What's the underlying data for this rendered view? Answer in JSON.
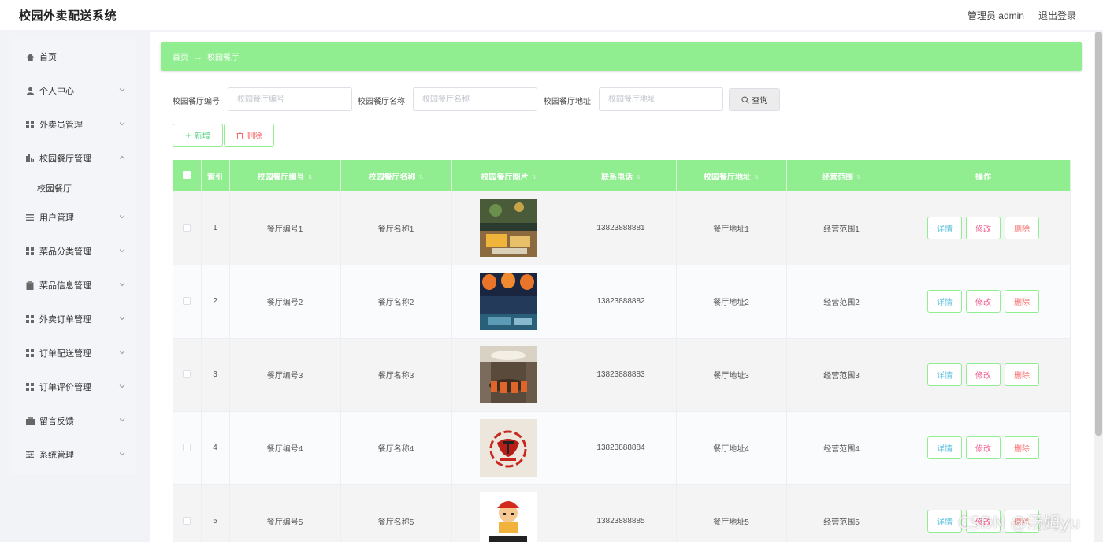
{
  "app": {
    "title": "校园外卖配送系统",
    "user_label": "管理员 admin",
    "logout_label": "退出登录"
  },
  "sidebar": {
    "items": [
      {
        "label": "首页",
        "icon": "home-icon"
      },
      {
        "label": "个人中心",
        "icon": "user-icon"
      },
      {
        "label": "外卖员管理",
        "icon": "grid-icon"
      },
      {
        "label": "校园餐厅管理",
        "icon": "chart-icon"
      },
      {
        "label": "校园餐厅",
        "icon": ""
      },
      {
        "label": "用户管理",
        "icon": "list-icon"
      },
      {
        "label": "菜品分类管理",
        "icon": "grid-icon"
      },
      {
        "label": "菜品信息管理",
        "icon": "clipboard-icon"
      },
      {
        "label": "外卖订单管理",
        "icon": "grid-icon"
      },
      {
        "label": "订单配送管理",
        "icon": "grid-icon"
      },
      {
        "label": "订单评价管理",
        "icon": "grid-icon"
      },
      {
        "label": "留言反馈",
        "icon": "message-icon"
      },
      {
        "label": "系统管理",
        "icon": "sliders-icon"
      }
    ]
  },
  "breadcrumb": {
    "home": "首页",
    "arrow": "→",
    "current": "校园餐厅"
  },
  "search": {
    "code_label": "校园餐厅编号",
    "code_placeholder": "校园餐厅编号",
    "name_label": "校园餐厅名称",
    "name_placeholder": "校园餐厅名称",
    "addr_label": "校园餐厅地址",
    "addr_placeholder": "校园餐厅地址",
    "query_label": "查询"
  },
  "toolbar": {
    "add_label": "新增",
    "delete_label": "删除"
  },
  "table": {
    "headers": [
      "索引",
      "校园餐厅编号",
      "校园餐厅名称",
      "校园餐厅图片",
      "联系电话",
      "校园餐厅地址",
      "经营范围",
      "操作"
    ],
    "actions": {
      "detail": "详情",
      "edit": "修改",
      "delete": "删除"
    },
    "rows": [
      {
        "index": "1",
        "code": "餐厅编号1",
        "name": "餐厅名称1",
        "phone": "13823888881",
        "address": "餐厅地址1",
        "scope": "经营范围1"
      },
      {
        "index": "2",
        "code": "餐厅编号2",
        "name": "餐厅名称2",
        "phone": "13823888882",
        "address": "餐厅地址2",
        "scope": "经营范围2"
      },
      {
        "index": "3",
        "code": "餐厅编号3",
        "name": "餐厅名称3",
        "phone": "13823888883",
        "address": "餐厅地址3",
        "scope": "经营范围3"
      },
      {
        "index": "4",
        "code": "餐厅编号4",
        "name": "餐厅名称4",
        "phone": "13823888884",
        "address": "餐厅地址4",
        "scope": "经营范围4"
      },
      {
        "index": "5",
        "code": "餐厅编号5",
        "name": "餐厅名称5",
        "phone": "13823888885",
        "address": "餐厅地址5",
        "scope": "经营范围5"
      }
    ]
  },
  "colors": {
    "accent": "#90ee90",
    "danger": "#f56c6c",
    "detail": "#5bc0de",
    "edit": "#f06292"
  },
  "watermark": "CSDN @汤姆yu"
}
